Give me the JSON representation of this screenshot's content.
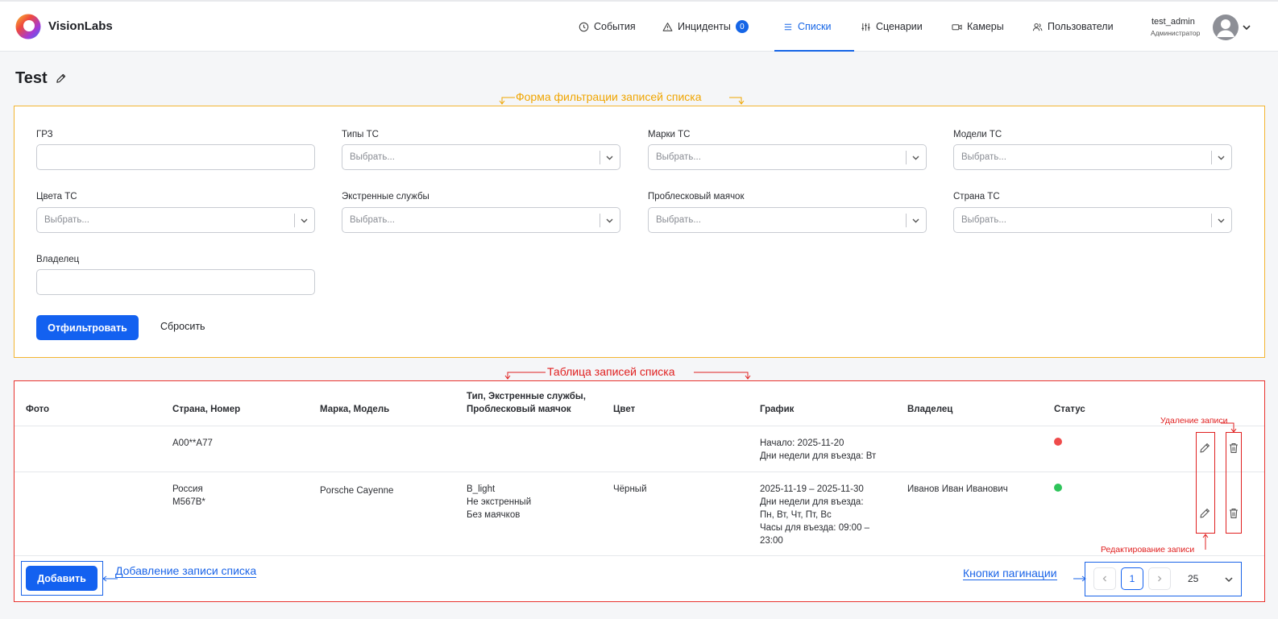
{
  "brand": {
    "name": "VisionLabs"
  },
  "nav": {
    "items": [
      {
        "label": "События",
        "icon": "clock-icon"
      },
      {
        "label": "Инциденты",
        "icon": "warning-triangle-icon",
        "badge": "0"
      },
      {
        "label": "Списки",
        "icon": "list-icon",
        "active": true
      },
      {
        "label": "Сценарии",
        "icon": "sliders-icon"
      },
      {
        "label": "Камеры",
        "icon": "camera-icon"
      },
      {
        "label": "Пользователи",
        "icon": "users-icon"
      }
    ],
    "user": {
      "name": "test_admin",
      "role": "Администратор"
    }
  },
  "page": {
    "title": "Test"
  },
  "filter": {
    "fields": {
      "plate": {
        "label": "ГРЗ",
        "value": ""
      },
      "types": {
        "label": "Типы ТС",
        "placeholder": "Выбрать..."
      },
      "brands": {
        "label": "Марки ТС",
        "placeholder": "Выбрать..."
      },
      "models": {
        "label": "Модели ТС",
        "placeholder": "Выбрать..."
      },
      "colors": {
        "label": "Цвета ТС",
        "placeholder": "Выбрать..."
      },
      "emergency": {
        "label": "Экстренные службы",
        "placeholder": "Выбрать..."
      },
      "beacon": {
        "label": "Проблесковый маячок",
        "placeholder": "Выбрать..."
      },
      "country": {
        "label": "Страна ТС",
        "placeholder": "Выбрать..."
      },
      "owner": {
        "label": "Владелец",
        "value": ""
      }
    },
    "apply_label": "Отфильтровать",
    "reset_label": "Сбросить"
  },
  "table": {
    "headers": {
      "photo": "Фото",
      "plate": "Страна, Номер",
      "model": "Марка, Модель",
      "type_line1": "Тип, Экстренные службы,",
      "type_line2": "Проблесковый маячок",
      "color": "Цвет",
      "schedule": "График",
      "owner": "Владелец",
      "status": "Статус"
    },
    "rows": [
      {
        "plate": "А00**А77",
        "schedule_l1": "Начало: 2025-11-20",
        "schedule_l2": "Дни недели для въезда: Вт",
        "status_color": "#ef4b4b"
      },
      {
        "plate_country": "Россия",
        "plate_number": "М567В*",
        "model": "Porsche Cayenne",
        "type_l1": "B_light",
        "type_l2": "Не экстренный",
        "type_l3": "Без маячков",
        "color": "Чёрный",
        "schedule_l1": "2025-11-19 – 2025-11-30",
        "schedule_l2": "Дни недели для въезда:",
        "schedule_l3": "Пн, Вт, Чт, Пт, Вс",
        "schedule_l4": "Часы для въезда: 09:00 –",
        "schedule_l5": "23:00",
        "owner": "Иванов Иван Иванович",
        "status_color": "#2ec45a"
      }
    ],
    "add_label": "Добавить"
  },
  "pagination": {
    "current_page": "1",
    "page_size": "25"
  },
  "annotations": {
    "filter_form": "Форма фильтрации записей списка",
    "table": "Таблица записей списка",
    "delete": "Удаление записи",
    "edit": "Редактирование записи",
    "add": "Добавление записи списка",
    "pagination": "Кнопки пагинации"
  },
  "colors": {
    "accent": "#1361f0",
    "annotation_orange": "#f0a500",
    "annotation_red": "#e02020",
    "annotation_blue": "#1a64e8"
  }
}
